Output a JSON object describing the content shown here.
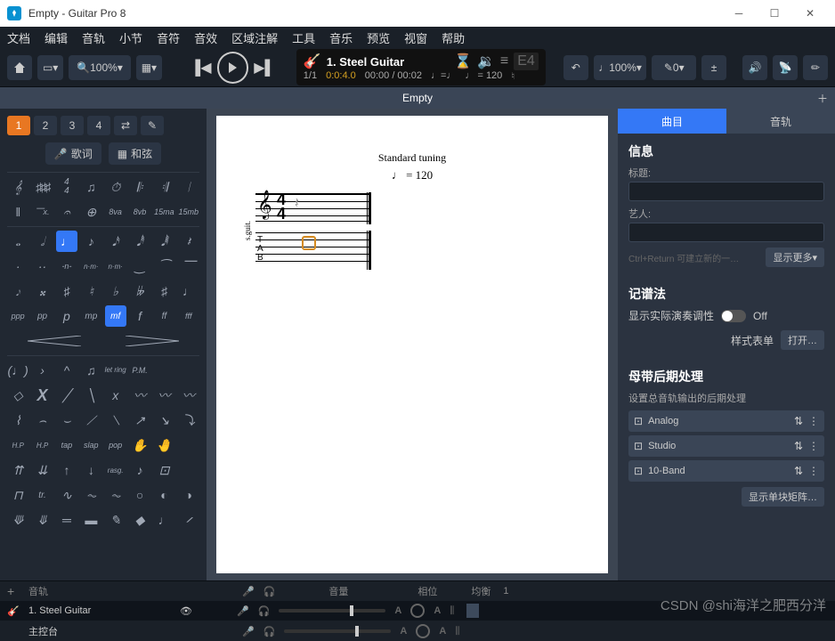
{
  "window": {
    "title": "Empty - Guitar Pro 8"
  },
  "menu": [
    "文档",
    "编辑",
    "音轨",
    "小节",
    "音符",
    "音效",
    "区域注解",
    "工具",
    "音乐",
    "预览",
    "视窗",
    "帮助"
  ],
  "toolbar": {
    "zoom": "100%",
    "track_number": "1.",
    "track_name": "Steel Guitar",
    "bars": "1/1",
    "duration": "0:0:4.0",
    "time_pos": "00:00 / 00:02",
    "tempo_note": "♩=♩",
    "tempo": "♩ = 120",
    "chord_display": "E4",
    "pct": "100%",
    "slash_val": "0"
  },
  "tab": {
    "title": "Empty"
  },
  "palette": {
    "voices": [
      "1",
      "2",
      "3",
      "4"
    ],
    "lyrics_btn": "歌词",
    "chords_btn": "和弦",
    "dynamics": [
      "ppp",
      "pp",
      "p",
      "mp",
      "mf",
      "f",
      "ff",
      "fff"
    ],
    "tech": [
      "tap",
      "slap",
      "pop"
    ],
    "rasg": "rasg.",
    "tr": "tr.",
    "octave": [
      "8va",
      "8vb",
      "15ma",
      "15mb"
    ],
    "let_ring": "let ring",
    "pm": "P.M.",
    "nm": [
      "-n-",
      "n·m·",
      "n·m·"
    ]
  },
  "score": {
    "tuning": "Standard tuning",
    "tempo": "♩ = 120",
    "side_label": "s.guit.",
    "timesig_num": "4",
    "timesig_den": "4",
    "tab_letters": [
      "T",
      "A",
      "B"
    ]
  },
  "inspector": {
    "tabs": [
      "曲目",
      "音轨"
    ],
    "info_heading": "信息",
    "title_label": "标题:",
    "artist_label": "艺人:",
    "hint": "Ctrl+Return 可建立新的一…",
    "show_more": "显示更多",
    "notation_heading": "记谱法",
    "concert_pitch": "显示实际演奏调性",
    "toggle_off": "Off",
    "stylesheet": "样式表单",
    "open_btn": "打开…",
    "mastering_heading": "母带后期处理",
    "mastering_desc": "设置总音轨输出的后期处理",
    "effects": [
      "Analog",
      "Studio",
      "10-Band"
    ],
    "matrix_btn": "显示单块矩阵…"
  },
  "tracks": {
    "header": [
      "音轨",
      "音量",
      "相位",
      "均衡"
    ],
    "track1_num": "1.",
    "track1_name": "Steel Guitar",
    "master": "主控台",
    "add": "+",
    "value1": "1"
  },
  "watermark": "CSDN @shi海洋之肥西分洋"
}
